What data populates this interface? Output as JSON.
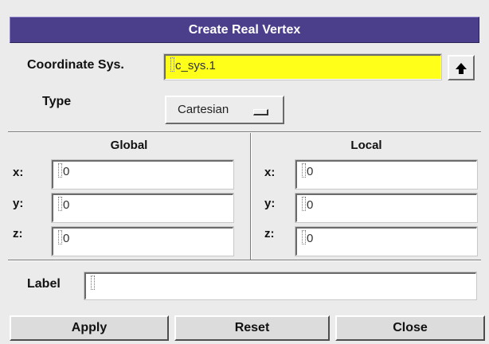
{
  "dialog": {
    "title": "Create Real Vertex"
  },
  "coord_sys": {
    "label": "Coordinate Sys.",
    "value": "c_sys.1",
    "highlight_color": "#ffff1a",
    "browse_icon": "arrow-up-icon"
  },
  "type": {
    "label": "Type",
    "selected": "Cartesian"
  },
  "global": {
    "title": "Global",
    "x_label": "x:",
    "x_value": "0",
    "y_label": "y:",
    "y_value": "0",
    "z_label": "z:",
    "z_value": "0"
  },
  "local": {
    "title": "Local",
    "x_label": "x:",
    "x_value": "0",
    "y_label": "y:",
    "y_value": "0",
    "z_label": "z:",
    "z_value": "0"
  },
  "label_field": {
    "label": "Label",
    "value": ""
  },
  "buttons": {
    "apply": "Apply",
    "reset": "Reset",
    "close": "Close"
  },
  "colors": {
    "titlebar": "#4b3f8c",
    "background": "#ebebeb"
  }
}
